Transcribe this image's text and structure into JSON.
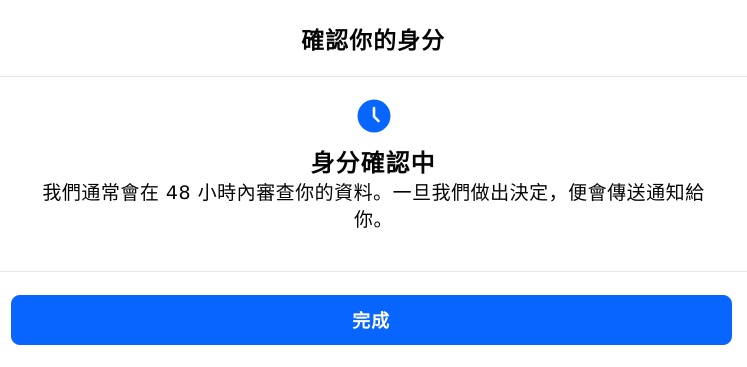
{
  "header": {
    "title": "確認你的身分"
  },
  "status": {
    "icon": "clock-icon",
    "title": "身分確認中",
    "description": "我們通常會在 48 小時內審查你的資料。一旦我們做出決定，便會傳送通知給你。"
  },
  "footer": {
    "done_label": "完成"
  },
  "colors": {
    "accent": "#0866ff",
    "divider": "#e4e6eb",
    "text": "#050505"
  }
}
